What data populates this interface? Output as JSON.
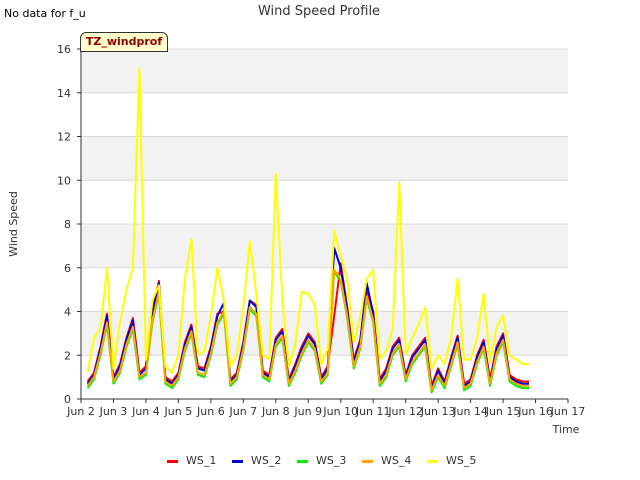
{
  "no_data_text": "No data for f_u",
  "badge_text": "TZ_windprof",
  "chart_data": {
    "type": "line",
    "title": "Wind Speed Profile",
    "xlabel": "Time",
    "ylabel": "Wind Speed",
    "xlim": [
      2,
      17
    ],
    "ylim": [
      0,
      16
    ],
    "x_ticks": [
      2,
      3,
      4,
      5,
      6,
      7,
      8,
      9,
      10,
      11,
      12,
      13,
      14,
      15,
      16,
      17
    ],
    "x_tick_labels": [
      "Jun 2",
      "Jun 3",
      "Jun 4",
      "Jun 5",
      "Jun 6",
      "Jun 7",
      "Jun 8",
      "Jun 9",
      "Jun 10",
      "Jun 11",
      "Jun 12",
      "Jun 13",
      "Jun 14",
      "Jun 15",
      "Jun 16",
      "Jun 17"
    ],
    "y_ticks": [
      0,
      2,
      4,
      6,
      8,
      10,
      12,
      14,
      16
    ],
    "y_tick_labels": [
      "0",
      "2",
      "4",
      "6",
      "8",
      "10",
      "12",
      "14",
      "16"
    ],
    "grid": true,
    "legend_position": "bottom",
    "x": [
      2.2,
      2.4,
      2.6,
      2.8,
      3.0,
      3.2,
      3.4,
      3.6,
      3.8,
      4.0,
      4.2,
      4.4,
      4.6,
      4.8,
      5.0,
      5.2,
      5.4,
      5.6,
      5.8,
      6.0,
      6.2,
      6.4,
      6.6,
      6.8,
      7.0,
      7.2,
      7.4,
      7.6,
      7.8,
      8.0,
      8.2,
      8.4,
      8.6,
      8.8,
      9.0,
      9.2,
      9.4,
      9.6,
      9.8,
      10.0,
      10.2,
      10.4,
      10.6,
      10.8,
      11.0,
      11.2,
      11.4,
      11.6,
      11.8,
      12.0,
      12.2,
      12.4,
      12.6,
      12.8,
      13.0,
      13.2,
      13.4,
      13.6,
      13.8,
      14.0,
      14.2,
      14.4,
      14.6,
      14.8,
      15.0,
      15.2,
      15.4,
      15.6,
      15.8
    ],
    "series": [
      {
        "name": "WS_1",
        "color": "#ff0000",
        "values": [
          0.8,
          1.2,
          2.4,
          3.9,
          1.0,
          1.6,
          2.8,
          3.7,
          1.2,
          1.5,
          4.0,
          5.4,
          1.0,
          0.8,
          1.2,
          2.6,
          3.4,
          1.5,
          1.4,
          2.4,
          3.9,
          4.0,
          0.9,
          1.2,
          2.6,
          4.5,
          4.3,
          1.3,
          1.1,
          2.8,
          3.2,
          0.9,
          1.6,
          2.4,
          3.0,
          2.6,
          1.0,
          1.5,
          3.8,
          6.2,
          4.2,
          1.8,
          2.7,
          5.0,
          4.0,
          0.9,
          1.4,
          2.4,
          2.8,
          1.1,
          2.0,
          2.4,
          2.8,
          0.6,
          1.4,
          0.8,
          1.9,
          2.9,
          0.7,
          0.9,
          2.0,
          2.7,
          0.9,
          2.4,
          3.0,
          1.1,
          0.9,
          0.8,
          0.8
        ]
      },
      {
        "name": "WS_2",
        "color": "#0000cc",
        "values": [
          0.7,
          1.1,
          2.3,
          3.8,
          0.9,
          1.5,
          2.7,
          3.6,
          1.1,
          1.4,
          3.9,
          5.3,
          0.9,
          0.7,
          1.1,
          2.5,
          3.3,
          1.4,
          1.3,
          2.3,
          3.8,
          4.4,
          0.8,
          1.1,
          2.5,
          4.5,
          4.2,
          1.2,
          1.0,
          2.7,
          3.1,
          0.8,
          1.5,
          2.3,
          2.9,
          2.5,
          0.9,
          1.4,
          6.9,
          6.0,
          4.1,
          1.7,
          2.6,
          5.3,
          3.9,
          0.8,
          1.3,
          2.3,
          2.7,
          1.0,
          1.9,
          2.3,
          2.7,
          0.5,
          1.3,
          0.7,
          1.8,
          2.8,
          0.6,
          0.8,
          1.9,
          2.6,
          0.8,
          2.3,
          2.9,
          1.0,
          0.8,
          0.7,
          0.7
        ]
      },
      {
        "name": "WS_3",
        "color": "#00ee00",
        "values": [
          0.5,
          0.9,
          2.0,
          3.4,
          0.7,
          1.2,
          2.4,
          3.2,
          0.9,
          1.1,
          3.5,
          4.8,
          0.7,
          0.5,
          0.9,
          2.2,
          3.0,
          1.1,
          1.0,
          2.0,
          3.4,
          3.9,
          0.6,
          0.9,
          2.2,
          4.1,
          3.8,
          1.0,
          0.8,
          2.4,
          2.8,
          0.6,
          1.2,
          2.0,
          2.6,
          2.2,
          0.7,
          1.1,
          5.8,
          5.4,
          3.7,
          1.4,
          2.3,
          4.6,
          3.5,
          0.6,
          1.0,
          2.0,
          2.4,
          0.8,
          1.6,
          2.0,
          2.4,
          0.3,
          1.0,
          0.5,
          1.5,
          2.5,
          0.4,
          0.6,
          1.6,
          2.3,
          0.6,
          2.0,
          2.6,
          0.8,
          0.6,
          0.5,
          0.5
        ]
      },
      {
        "name": "WS_4",
        "color": "#ffa500",
        "values": [
          0.6,
          1.0,
          2.1,
          3.5,
          0.8,
          1.3,
          2.5,
          3.3,
          1.0,
          1.2,
          3.6,
          4.9,
          0.8,
          0.6,
          1.0,
          2.3,
          3.1,
          1.2,
          1.1,
          2.1,
          3.5,
          4.0,
          0.7,
          1.0,
          2.3,
          4.2,
          3.9,
          1.1,
          0.9,
          2.5,
          2.9,
          0.7,
          1.3,
          2.1,
          2.7,
          2.3,
          0.8,
          1.2,
          5.9,
          5.5,
          3.8,
          1.5,
          2.4,
          4.7,
          3.6,
          0.7,
          1.1,
          2.1,
          2.5,
          0.9,
          1.7,
          2.1,
          2.5,
          0.4,
          1.1,
          0.6,
          1.6,
          2.6,
          0.5,
          0.7,
          1.7,
          2.4,
          0.7,
          2.1,
          2.7,
          0.9,
          0.7,
          0.6,
          0.6
        ]
      },
      {
        "name": "WS_5",
        "color": "#ffff00",
        "values": [
          1.2,
          2.8,
          3.2,
          6.0,
          1.4,
          3.5,
          5.0,
          6.0,
          15.1,
          1.8,
          4.5,
          5.2,
          1.5,
          1.2,
          2.0,
          5.5,
          7.3,
          2.0,
          2.2,
          3.8,
          6.0,
          4.5,
          1.5,
          2.0,
          4.2,
          7.2,
          4.8,
          2.0,
          1.8,
          10.3,
          4.6,
          1.5,
          2.5,
          4.9,
          4.8,
          4.3,
          1.6,
          2.3,
          7.7,
          6.5,
          5.5,
          2.6,
          3.7,
          5.5,
          5.9,
          1.8,
          2.2,
          3.2,
          9.9,
          2.0,
          2.8,
          3.4,
          4.2,
          1.4,
          2.0,
          1.6,
          2.8,
          5.5,
          1.8,
          1.8,
          2.8,
          4.8,
          1.7,
          3.3,
          3.8,
          2.0,
          1.8,
          1.6,
          1.6
        ]
      }
    ]
  }
}
